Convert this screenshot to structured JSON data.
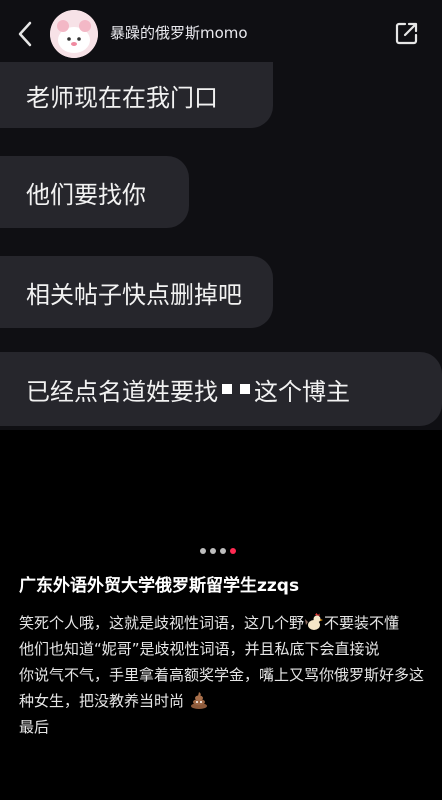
{
  "header": {
    "contact_name": "暴躁的俄罗斯momo",
    "back_icon": "chevron-left-icon",
    "share_icon": "share-out-icon"
  },
  "messages": [
    "老师现在在我门口",
    "他们要找你",
    "相关帖子快点删掉吧",
    {
      "before": "已经点名道姓要找",
      "after": "这个博主"
    }
  ],
  "carousel": {
    "count": 4,
    "active_index": 3,
    "active_color": "#ff2a52"
  },
  "post": {
    "title": "广东外语外贸大学俄罗斯留学生zzqs",
    "lines": [
      {
        "text": "笑死个人哦，这就是歧视性词语，这几个野",
        "emoji": "rooster-icon",
        "after": "不要装不懂"
      },
      {
        "text": "他们也知道“妮哥”是歧视性词语，并且私底下会直接说"
      },
      {
        "text": "你说气不气，手里拿着高额奖学金，嘴上又骂你俄罗斯好多这种女生，把没教养当时尚",
        "emoji": "poop-icon",
        "after": ""
      },
      {
        "text": "最后"
      }
    ]
  }
}
